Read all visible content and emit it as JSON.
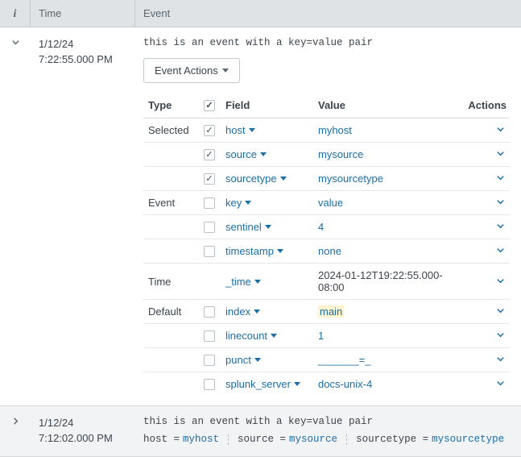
{
  "columns": {
    "i": "i",
    "time": "Time",
    "event": "Event"
  },
  "event_actions_label": "Event Actions",
  "field_headers": {
    "type": "Type",
    "field": "Field",
    "value": "Value",
    "actions": "Actions"
  },
  "events": [
    {
      "date": "1/12/24",
      "time": "7:22:55.000 PM",
      "raw": "this is an event with a key=value pair",
      "expanded": true,
      "groups": [
        {
          "label": "Selected",
          "rows": [
            {
              "field": "host",
              "value": "myhost",
              "checked": true
            },
            {
              "field": "source",
              "value": "mysource",
              "checked": true
            },
            {
              "field": "sourcetype",
              "value": "mysourcetype",
              "checked": true
            }
          ]
        },
        {
          "label": "Event",
          "rows": [
            {
              "field": "key",
              "value": "value",
              "checked": false
            },
            {
              "field": "sentinel",
              "value": "4",
              "checked": false
            },
            {
              "field": "timestamp",
              "value": "none",
              "checked": false
            }
          ]
        },
        {
          "label": "Time",
          "rows": [
            {
              "field": "_time",
              "value": "2024-01-12T19:22:55.000-08:00",
              "no_check": true,
              "value_plain": true
            }
          ]
        },
        {
          "label": "Default",
          "rows": [
            {
              "field": "index",
              "value": "main",
              "checked": false,
              "highlight": true
            },
            {
              "field": "linecount",
              "value": "1",
              "checked": false
            },
            {
              "field": "punct",
              "value": "_______=_",
              "checked": false
            },
            {
              "field": "splunk_server",
              "value": "docs-unix-4",
              "checked": false
            }
          ]
        }
      ]
    },
    {
      "date": "1/12/24",
      "time": "7:12:02.000 PM",
      "raw": "this is an event with a key=value pair",
      "expanded": false,
      "summary": [
        {
          "k": "host",
          "v": "myhost"
        },
        {
          "k": "source",
          "v": "mysource"
        },
        {
          "k": "sourcetype",
          "v": "mysourcetype"
        }
      ]
    }
  ]
}
